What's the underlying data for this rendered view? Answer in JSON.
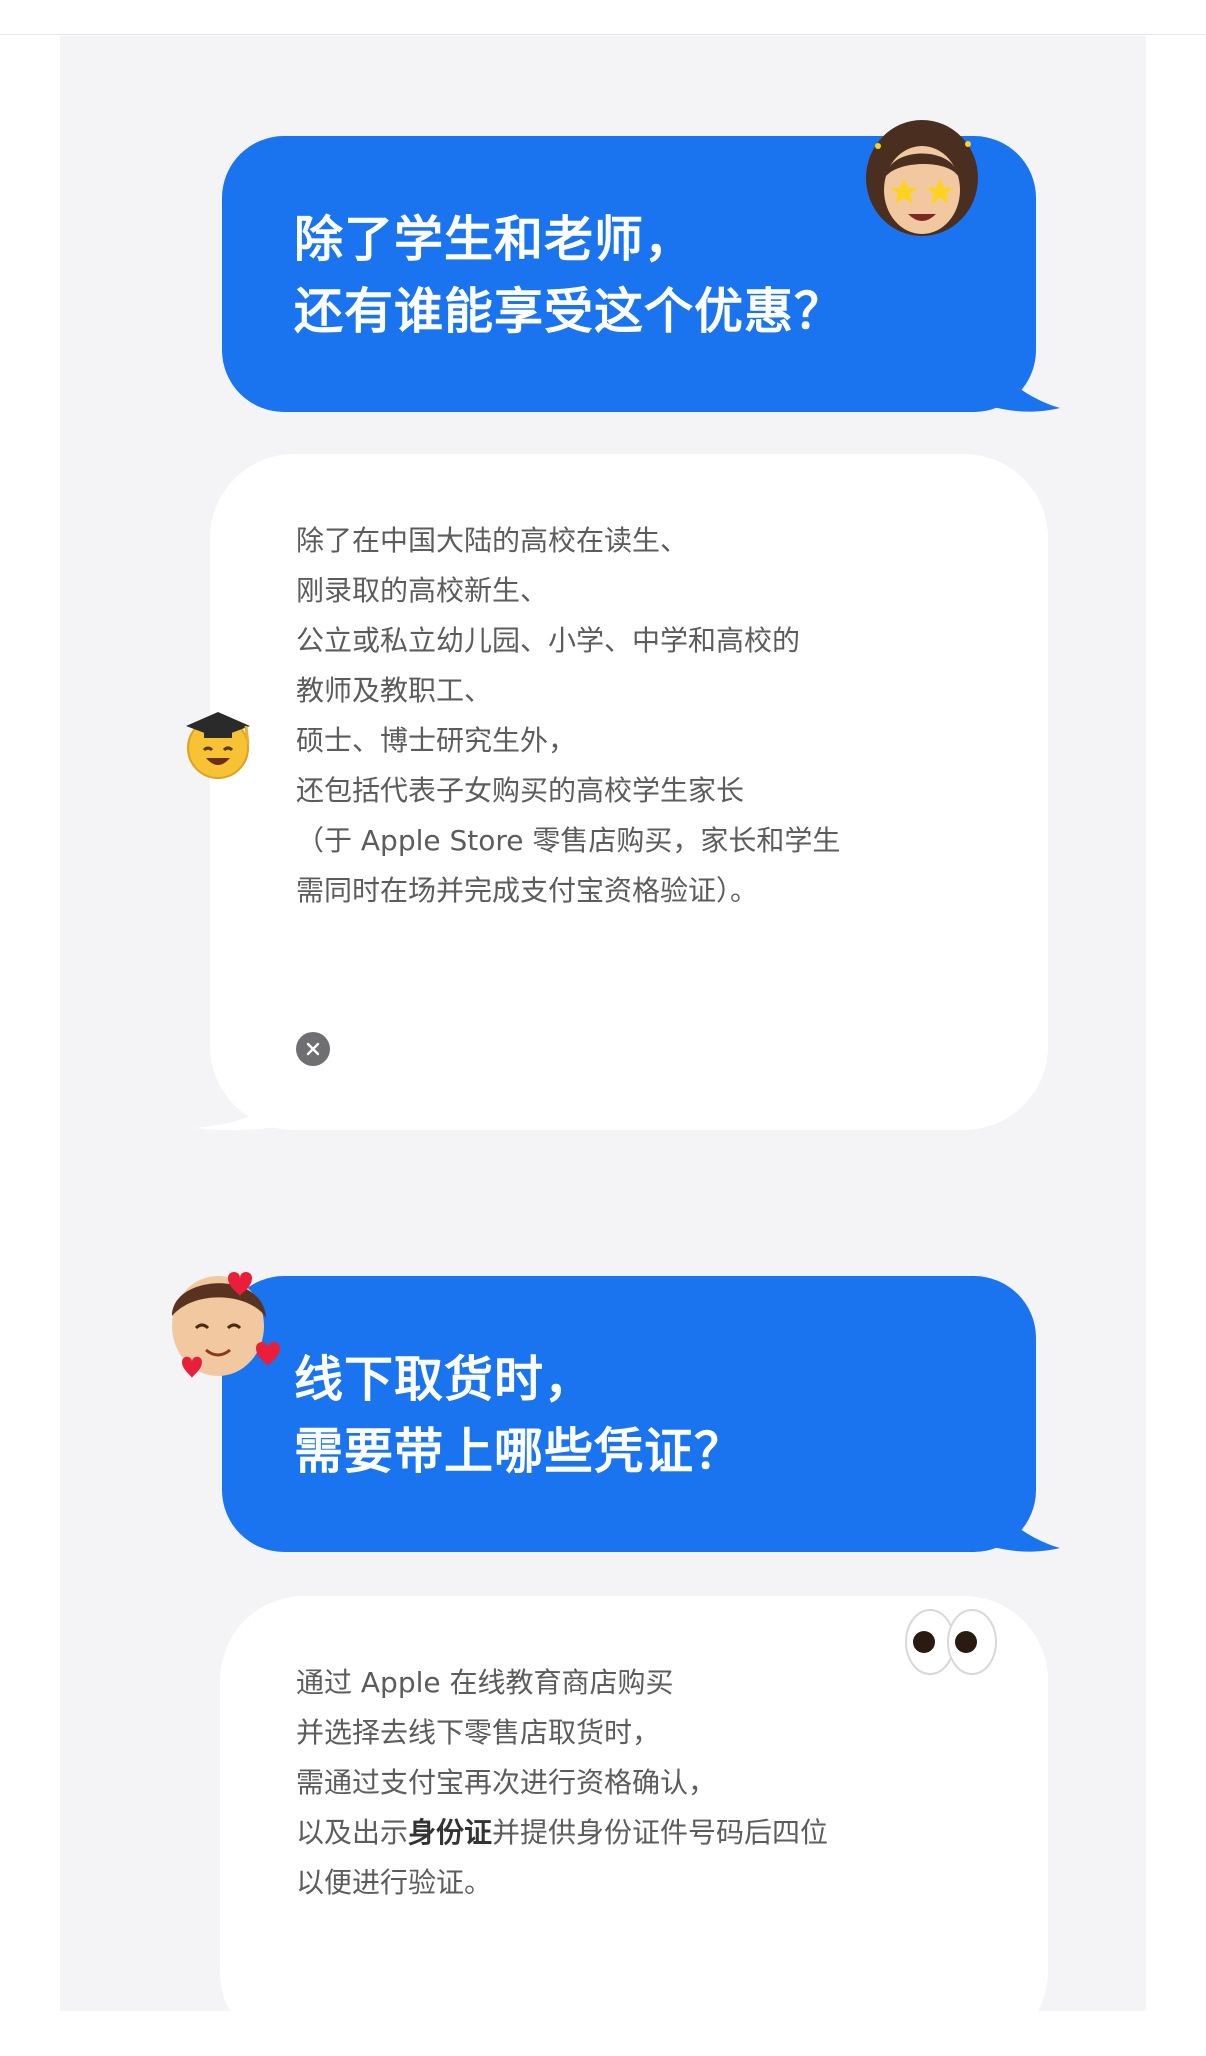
{
  "messages": [
    {
      "type": "question",
      "text": "除了学生和老师，\n还有谁能享受这个优惠？",
      "avatar_icon": "memoji-star-eyes-icon"
    },
    {
      "type": "answer",
      "text": "除了在中国大陆的高校在读生、\n刚录取的高校新生、\n公立或私立幼儿园、小学、中学和高校的\n教师及教职工、\n硕士、博士研究生外，\n还包括代表子女购买的高校学生家长\n（于 Apple Store 零售店购买，家长和学生\n需同时在场并完成支付宝资格验证）。",
      "avatar_icon": "graduation-cap-emoji-icon",
      "close_icon": "close-icon"
    },
    {
      "type": "question",
      "text": "线下取货时，\n需要带上哪些凭证？",
      "avatar_icon": "memoji-hearts-icon"
    },
    {
      "type": "answer",
      "text_before": "通过 Apple 在线教育商店购买\n并选择去线下零售店取货时，\n需通过支付宝再次进行资格确认，\n以及出示",
      "text_bold": "身份证",
      "text_after": "并提供身份证件号码后四位\n以便进行验证。",
      "avatar_icon": "eyes-emoji-icon"
    }
  ],
  "colors": {
    "bubble_blue": "#1a74f0",
    "panel_bg": "#f4f4f6",
    "answer_text": "#5c5c5c"
  }
}
